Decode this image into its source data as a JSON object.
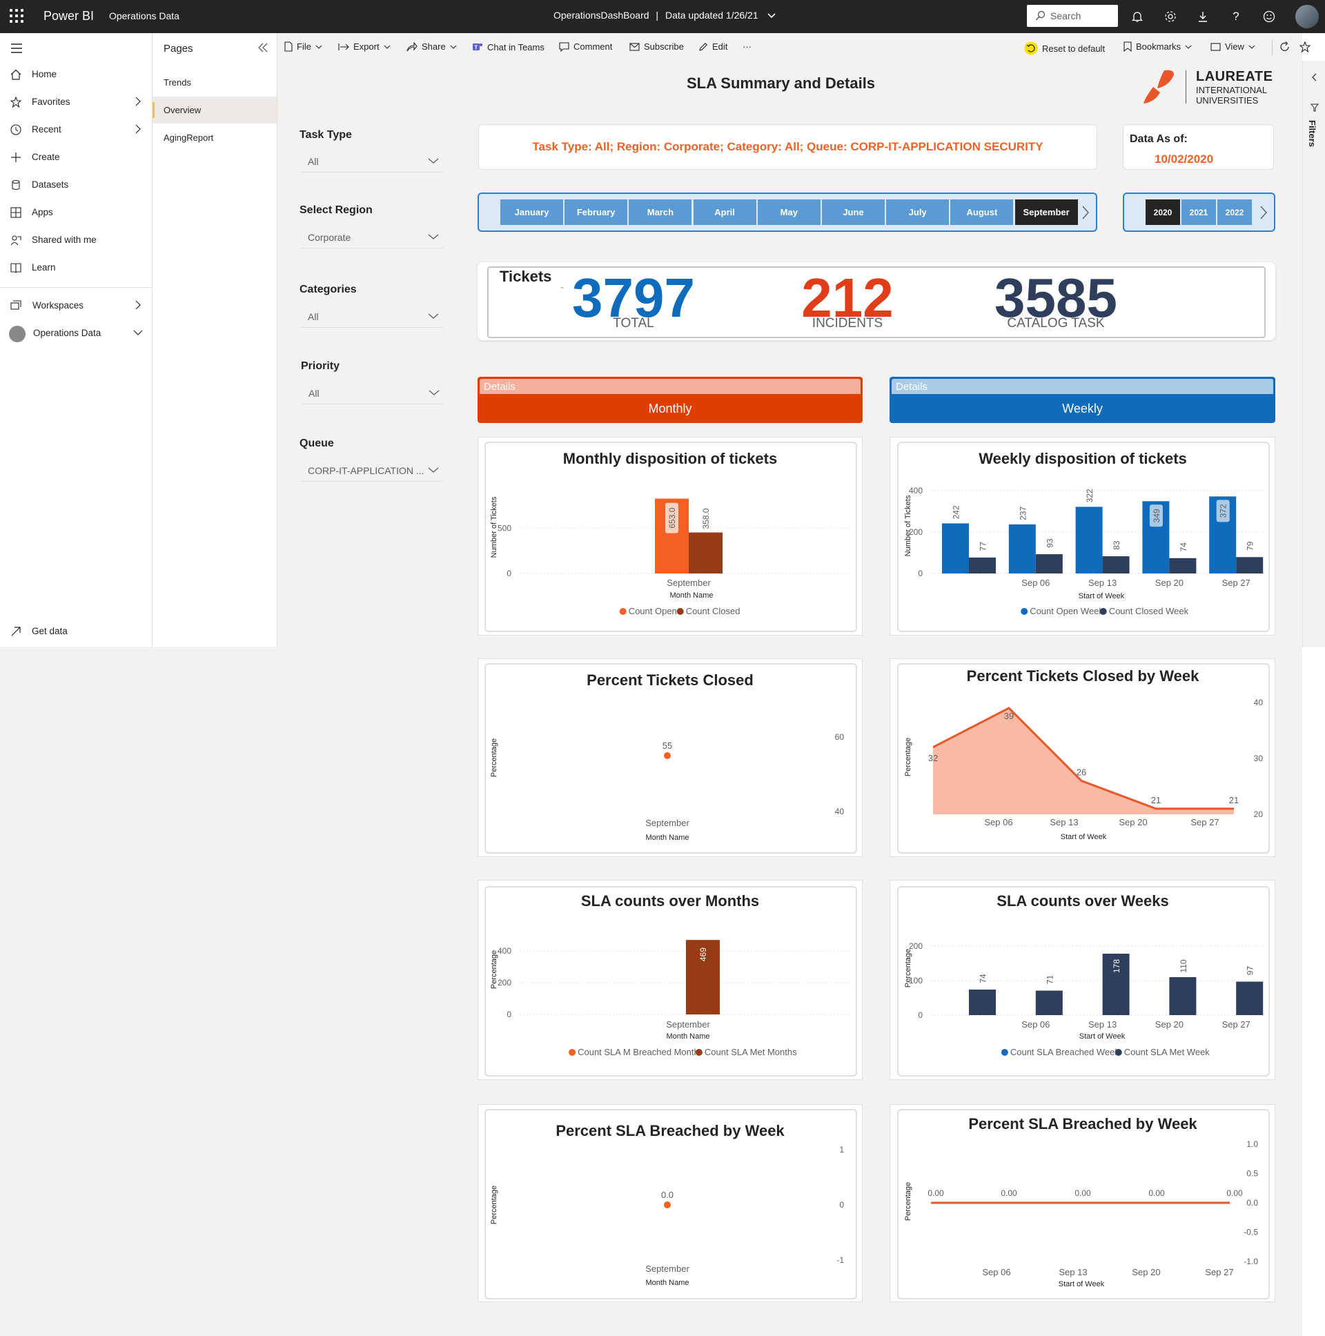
{
  "topbar": {
    "brand": "Power BI",
    "workspace": "Operations Data",
    "report_name": "OperationsDashBoard",
    "separator": "|",
    "data_updated": "Data updated 1/26/21",
    "search_placeholder": "Search"
  },
  "leftnav": {
    "items": [
      {
        "label": "Home",
        "icon": "home-icon"
      },
      {
        "label": "Favorites",
        "icon": "star-icon"
      },
      {
        "label": "Recent",
        "icon": "clock-icon"
      },
      {
        "label": "Create",
        "icon": "plus-icon"
      },
      {
        "label": "Datasets",
        "icon": "database-icon"
      },
      {
        "label": "Apps",
        "icon": "apps-icon"
      },
      {
        "label": "Shared with me",
        "icon": "shared-icon"
      },
      {
        "label": "Learn",
        "icon": "book-icon"
      },
      {
        "label": "Workspaces",
        "icon": "workspaces-icon"
      },
      {
        "label": "Operations Data",
        "icon": "workspace-avatar-icon"
      },
      {
        "label": "Get data",
        "icon": "arrow-up-right-icon"
      }
    ]
  },
  "pages": {
    "title": "Pages",
    "items": [
      "Trends",
      "Overview",
      "AgingReport"
    ],
    "active": "Overview"
  },
  "toolbar": {
    "file": "File",
    "export": "Export",
    "share": "Share",
    "chat": "Chat in Teams",
    "comment": "Comment",
    "subscribe": "Subscribe",
    "edit": "Edit",
    "more": "···",
    "reset": "Reset to default",
    "bookmarks": "Bookmarks",
    "view": "View"
  },
  "filters_pane_label": "Filters",
  "slicers": {
    "task_type": {
      "label": "Task Type",
      "value": "All"
    },
    "region": {
      "label": "Select Region",
      "value": "Corporate"
    },
    "categories": {
      "label": "Categories",
      "value": "All"
    },
    "priority": {
      "label": "Priority",
      "value": "All"
    },
    "queue": {
      "label": "Queue",
      "value": "CORP-IT-APPLICATION ..."
    }
  },
  "report": {
    "title": "SLA Summary and Details",
    "logo": {
      "line1": "LAUREATE",
      "line2": "INTERNATIONAL",
      "line3": "UNIVERSITIES",
      "color": "#e8562a"
    },
    "filter_summary": "Task Type: All; Region: Corporate; Category: All; Queue: CORP-IT-APPLICATION SECURITY",
    "data_as_of_label": "Data As of:",
    "data_as_of_value": "10/02/2020",
    "months": [
      "January",
      "February",
      "March",
      "April",
      "May",
      "June",
      "July",
      "August",
      "September"
    ],
    "selected_month": "September",
    "years": [
      "2020",
      "2021",
      "2022"
    ],
    "selected_year": "2020",
    "kpi": {
      "label": "Tickets",
      "dash": "-",
      "total": {
        "value": "3797",
        "caption": "TOTAL",
        "color": "#0f6cbd"
      },
      "incidents": {
        "value": "212",
        "caption": "INCIDENTS",
        "color": "#e03e1a"
      },
      "catalog": {
        "value": "3585",
        "caption": "CATALOG TASK",
        "color": "#2e3e5c"
      }
    },
    "monthly_tab": {
      "caption": "Details",
      "label": "Monthly"
    },
    "weekly_tab": {
      "caption": "Details",
      "label": "Weekly"
    }
  },
  "colors": {
    "orange": "#f26122",
    "brown": "#973c17",
    "blue": "#0f6cbd",
    "navy": "#2e3e5c",
    "area": "#f8baa3",
    "accent_red": "#e03e00"
  },
  "chart_data": [
    {
      "id": "monthly_disposition",
      "type": "bar",
      "title": "Monthly disposition of tickets",
      "xlabel": "Month Name",
      "ylabel": "Number of Tickets",
      "categories": [
        "September"
      ],
      "series": [
        {
          "name": "Count Open",
          "values": [
            653.0
          ]
        },
        {
          "name": "Count Closed",
          "values": [
            358.0
          ]
        }
      ],
      "data_labels": [
        "653.0",
        "358.0"
      ],
      "yticks": [
        0,
        500
      ],
      "ylim": [
        0,
        700
      ],
      "grid": true,
      "legend": "bottom"
    },
    {
      "id": "weekly_disposition",
      "type": "bar",
      "title": "Weekly disposition of tickets",
      "xlabel": "Start of Week",
      "ylabel": "Number of Tickets",
      "categories": [
        "",
        "Sep 06",
        "Sep 13",
        "Sep 20",
        "Sep 27"
      ],
      "series": [
        {
          "name": "Count Open Week",
          "values": [
            242,
            237,
            322,
            349,
            372
          ]
        },
        {
          "name": "Count Closed Week",
          "values": [
            77,
            93,
            83,
            74,
            79
          ]
        }
      ],
      "yticks": [
        0,
        200,
        400
      ],
      "ylim": [
        0,
        420
      ],
      "grid": true,
      "legend": "bottom"
    },
    {
      "id": "percent_closed",
      "type": "scatter",
      "title": "Percent Tickets Closed",
      "xlabel": "Month Name",
      "ylabel": "Percentage",
      "categories": [
        "September"
      ],
      "series": [
        {
          "values": [
            55
          ]
        }
      ],
      "yticks": [
        40,
        60
      ],
      "ylim": [
        36,
        66
      ],
      "y_axis": "right"
    },
    {
      "id": "percent_closed_week",
      "type": "area",
      "title": "Percent Tickets Closed by Week",
      "xlabel": "Start of Week",
      "ylabel": "Percentage",
      "categories": [
        "",
        "Sep 06",
        "Sep 13",
        "Sep 20",
        "Sep 27"
      ],
      "series": [
        {
          "values": [
            32,
            39,
            26,
            21,
            21
          ]
        }
      ],
      "yticks": [
        20,
        30,
        40
      ],
      "ylim": [
        20,
        40
      ],
      "y_axis": "right"
    },
    {
      "id": "sla_months",
      "type": "bar",
      "title": "SLA counts over Months",
      "xlabel": "Month Name",
      "ylabel": "Percentage",
      "categories": [
        "September"
      ],
      "series": [
        {
          "name": "Count SLA M Breached Month",
          "values": [
            0
          ]
        },
        {
          "name": "Count SLA Met Months",
          "values": [
            469
          ]
        }
      ],
      "data_labels": [
        "469"
      ],
      "yticks": [
        0,
        200,
        400
      ],
      "ylim": [
        0,
        500
      ],
      "grid": true,
      "legend": "bottom"
    },
    {
      "id": "sla_weeks",
      "type": "bar",
      "title": "SLA counts over Weeks",
      "xlabel": "Start of Week",
      "ylabel": "Percentage",
      "categories": [
        "",
        "Sep 06",
        "Sep 13",
        "Sep 20",
        "Sep 27"
      ],
      "series": [
        {
          "name": "Count SLA Breached Week",
          "values": [
            0,
            0,
            0,
            0,
            0
          ]
        },
        {
          "name": "Count SLA Met Week",
          "values": [
            74,
            71,
            178,
            110,
            97
          ]
        }
      ],
      "yticks": [
        0,
        100,
        200
      ],
      "ylim": [
        0,
        200
      ],
      "grid": true,
      "legend": "bottom"
    },
    {
      "id": "percent_breached_month",
      "type": "scatter",
      "title": "Percent SLA Breached by Week",
      "xlabel": "Month Name",
      "ylabel": "Percentage",
      "categories": [
        "September"
      ],
      "series": [
        {
          "values": [
            0.0
          ]
        }
      ],
      "data_labels": [
        "0.0"
      ],
      "yticks": [
        -1,
        0,
        1
      ],
      "ylim": [
        -1,
        1
      ],
      "y_axis": "right"
    },
    {
      "id": "percent_breached_week",
      "type": "line",
      "title": "Percent SLA Breached by Week",
      "xlabel": "Start of Week",
      "ylabel": "Percentage",
      "categories": [
        "",
        "Sep 06",
        "Sep 13",
        "Sep 20",
        "Sep 27"
      ],
      "series": [
        {
          "values": [
            0.0,
            0.0,
            0.0,
            0.0,
            0.0
          ]
        }
      ],
      "data_labels": [
        "0.00",
        "0.00",
        "0.00",
        "0.00",
        "0.00"
      ],
      "yticks": [
        -1.0,
        -0.5,
        0.0,
        0.5,
        1.0
      ],
      "ylim": [
        -1.0,
        1.0
      ],
      "y_axis": "right"
    }
  ]
}
